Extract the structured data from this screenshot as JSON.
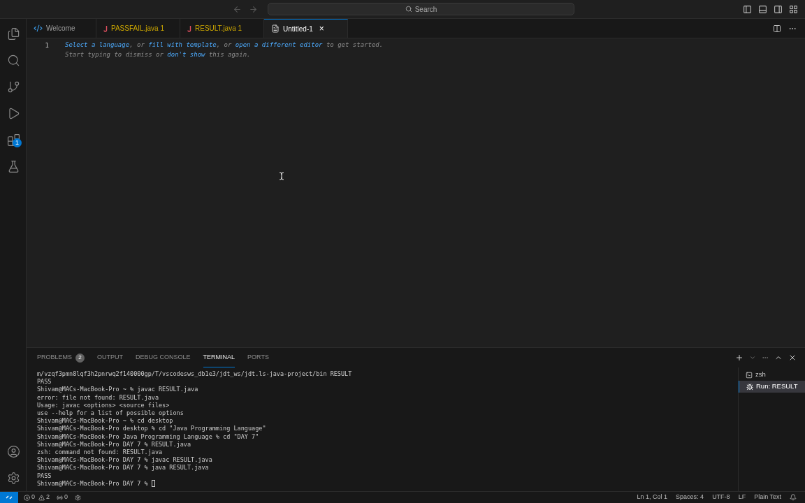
{
  "title_bar": {
    "search_label": "Search"
  },
  "activity_bar": {
    "items": [
      {
        "kind": "explorer"
      },
      {
        "kind": "search"
      },
      {
        "kind": "source-control"
      },
      {
        "kind": "run"
      },
      {
        "kind": "extensions",
        "badge": "1"
      },
      {
        "kind": "testing"
      }
    ],
    "bottom": [
      {
        "kind": "account"
      },
      {
        "kind": "settings"
      }
    ]
  },
  "tabs": [
    {
      "label": "Welcome",
      "kind": "welcome",
      "selected": false,
      "warning": false
    },
    {
      "label": "PASSFAIL.java",
      "count": "1",
      "kind": "java",
      "selected": false,
      "warning": true
    },
    {
      "label": "RESULT.java",
      "count": "1",
      "kind": "java",
      "selected": false,
      "warning": true
    },
    {
      "label": "Untitled-1",
      "kind": "text",
      "selected": true,
      "warning": false,
      "close": "×"
    }
  ],
  "editor": {
    "line_number": "1",
    "hint_lines": [
      [
        {
          "text": "Select a language",
          "link": true
        },
        {
          "text": ", or ",
          "link": false
        },
        {
          "text": "fill with template",
          "link": true
        },
        {
          "text": ", or ",
          "link": false
        },
        {
          "text": "open a different editor",
          "link": true
        },
        {
          "text": " to get started.",
          "link": false
        }
      ],
      [
        {
          "text": "Start typing to dismiss or ",
          "link": false
        },
        {
          "text": "don't show",
          "link": true
        },
        {
          "text": " this again.",
          "link": false
        }
      ]
    ]
  },
  "panel": {
    "tabs": [
      {
        "label": "PROBLEMS",
        "badge": "2",
        "selected": false
      },
      {
        "label": "OUTPUT",
        "selected": false
      },
      {
        "label": "DEBUG CONSOLE",
        "selected": false
      },
      {
        "label": "TERMINAL",
        "selected": true
      },
      {
        "label": "PORTS",
        "selected": false
      }
    ],
    "terminal_lines": [
      "m/vzqf3pmn8lqf3h2pnrwq2f140000gp/T/vscodesws_db1e3/jdt_ws/jdt.ls-java-project/bin RESULT",
      "PASS",
      "Shivam@MACs-MacBook-Pro ~ % javac RESULT.java",
      "error: file not found: RESULT.java",
      "Usage: javac <options> <source files>",
      "use --help for a list of possible options",
      "Shivam@MACs-MacBook-Pro ~ % cd desktop",
      "Shivam@MACs-MacBook-Pro desktop % cd \"Java Programming Language\"",
      "Shivam@MACs-MacBook-Pro Java Programming Language % cd \"DAY 7\"",
      "Shivam@MACs-MacBook-Pro DAY 7 % RESULT.java",
      "zsh: command not found: RESULT.java",
      "Shivam@MACs-MacBook-Pro DAY 7 % javac RESULT.java",
      "Shivam@MACs-MacBook-Pro DAY 7 % java RESULT.java",
      "PASS",
      "Shivam@MACs-MacBook-Pro DAY 7 % "
    ],
    "sessions": [
      {
        "label": "zsh",
        "kind": "shell",
        "selected": false
      },
      {
        "label": "Run: RESULT",
        "kind": "debug",
        "selected": true
      }
    ]
  },
  "status_bar": {
    "errors": "0",
    "warnings": "2",
    "ports": "0",
    "right": [
      "Ln 1, Col 1",
      "Spaces: 4",
      "UTF-8",
      "LF",
      "Plain Text"
    ]
  }
}
